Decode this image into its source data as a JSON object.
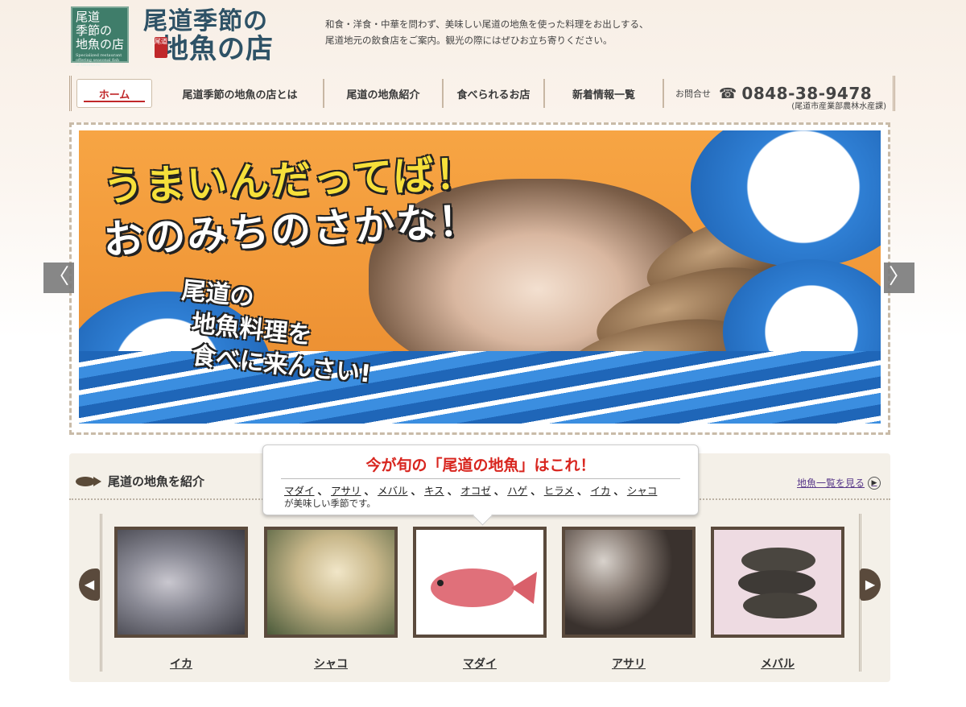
{
  "header": {
    "logo_box_lines": [
      "尾道",
      "季節の",
      "地魚の店"
    ],
    "logo_box_sub": "Specialized restaurant offering seasonal fish of Onomichi",
    "logo_title_line1": "尾道季節の",
    "logo_title_line2": "地魚の店",
    "logo_stamp": "尾道",
    "intro_line1": "和食・洋食・中華を問わず、美味しい尾道の地魚を使った料理をお出しする、",
    "intro_line2": "尾道地元の飲食店をご案内。観光の際にはぜひお立ち寄りください。"
  },
  "nav": {
    "items": [
      "ホーム",
      "尾道季節の地魚の店とは",
      "尾道の地魚紹介",
      "食べられるお店",
      "新着情報一覧"
    ],
    "contact_label": "お問合せ",
    "phone": "0848-38-9478",
    "dept": "(尾道市産業部農林水産課)"
  },
  "hero": {
    "headline1": "うまいんだってば！",
    "headline2": "おのみちのさかな！",
    "sub1": "尾道の",
    "sub2": "地魚料理を",
    "sub3": "食べに来んさい!",
    "prev": "〈",
    "next": "〉"
  },
  "fish_section": {
    "title": "尾道の地魚を紹介",
    "more_link": "地魚一覧を見る",
    "bubble_title": "今が旬の「尾道の地魚」はこれ！",
    "season_fish": [
      "マダイ",
      "アサリ",
      "メバル",
      "キス",
      "オコゼ",
      "ハゲ",
      "ヒラメ",
      "イカ",
      "シャコ"
    ],
    "season_note": "が美味しい季節です。",
    "cards": [
      {
        "label": "イカ",
        "color": "#6a6e78"
      },
      {
        "label": "シャコ",
        "color": "#b9a77c"
      },
      {
        "label": "マダイ",
        "color": "#ffffff"
      },
      {
        "label": "アサリ",
        "color": "#7b6e66"
      },
      {
        "label": "メバル",
        "color": "#e9d4dc"
      }
    ]
  },
  "colors": {
    "accent_red": "#d8261f",
    "logo_green": "#3f7d6a",
    "nav_active": "#c0282a"
  }
}
